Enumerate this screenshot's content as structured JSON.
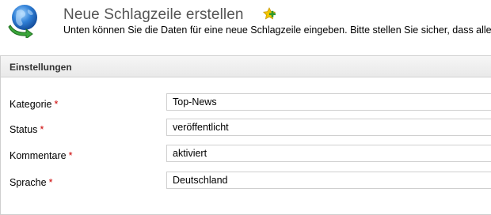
{
  "header": {
    "title": "Neue Schlagzeile erstellen",
    "subtitle": "Unten können Sie die Daten für eine neue Schlagzeile eingeben. Bitte stellen Sie sicher, dass alle n",
    "logo_icon": "globe-refresh-icon",
    "add_icon": "star-plus-icon"
  },
  "panel": {
    "title": "Einstellungen",
    "fields": [
      {
        "label": "Kategorie",
        "required": "*",
        "value": "Top-News"
      },
      {
        "label": "Status",
        "required": "*",
        "value": "veröffentlicht"
      },
      {
        "label": "Kommentare",
        "required": "*",
        "value": "aktiviert"
      },
      {
        "label": "Sprache",
        "required": "*",
        "value": "Deutschland"
      }
    ]
  },
  "colors": {
    "required_marker": "#cc0000",
    "title_text": "#555555",
    "panel_header_bg": "#eeeeee",
    "border": "#cfcfcf"
  }
}
